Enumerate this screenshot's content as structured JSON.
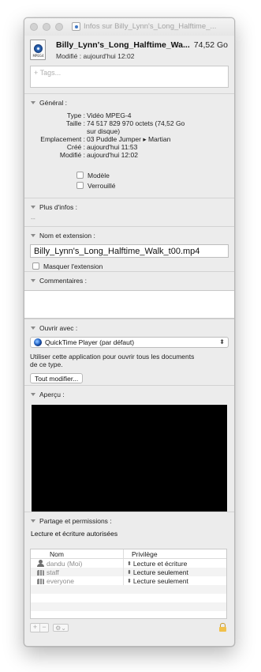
{
  "window": {
    "title": "Infos sur Billy_Lynn's_Long_Halftime_..."
  },
  "header": {
    "file_name": "Billy_Lynn's_Long_Halftime_Wa...",
    "file_size": "74,52 Go",
    "modified": "Modifié : aujourd'hui 12:02",
    "icon_ext": "MPEG4"
  },
  "tags": {
    "placeholder": "+ Tags..."
  },
  "general": {
    "title": "Général :",
    "rows": [
      {
        "label": "Type :",
        "value": "Vidéo MPEG-4"
      },
      {
        "label": "Taille :",
        "value": "74 517 829 970 octets (74,52 Go"
      },
      {
        "label": "",
        "value": "sur disque)"
      },
      {
        "label": "Emplacement :",
        "value": "03 Puddle Jumper ▸ Martian"
      },
      {
        "label": "Créé :",
        "value": "aujourd'hui 11:53"
      },
      {
        "label": "Modifié :",
        "value": "aujourd'hui 12:02"
      }
    ],
    "template_label": "Modèle",
    "locked_label": "Verrouillé"
  },
  "more_info": {
    "title": "Plus d'infos :",
    "value": "--"
  },
  "name_ext": {
    "title": "Nom et extension :",
    "value": "Billy_Lynn's_Long_Halftime_Walk_t00.mp4",
    "hide_ext_label": "Masquer l'extension"
  },
  "comments": {
    "title": "Commentaires :"
  },
  "open_with": {
    "title": "Ouvrir avec :",
    "app": "QuickTime Player (par défaut)",
    "description_line1": "Utiliser cette application pour ouvrir tous les documents",
    "description_line2": "de ce type.",
    "change_all_label": "Tout modifier..."
  },
  "preview": {
    "title": "Aperçu :"
  },
  "permissions": {
    "title": "Partage et permissions :",
    "subtitle": "Lecture et écriture autorisées",
    "col_name": "Nom",
    "col_priv": "Privilège",
    "rows": [
      {
        "name": "dandu (Moi)",
        "privilege": "Lecture et écriture",
        "icon": "single"
      },
      {
        "name": "staff",
        "privilege": "Lecture seulement",
        "icon": "multi"
      },
      {
        "name": "everyone",
        "privilege": "Lecture seulement",
        "icon": "multi"
      }
    ]
  }
}
